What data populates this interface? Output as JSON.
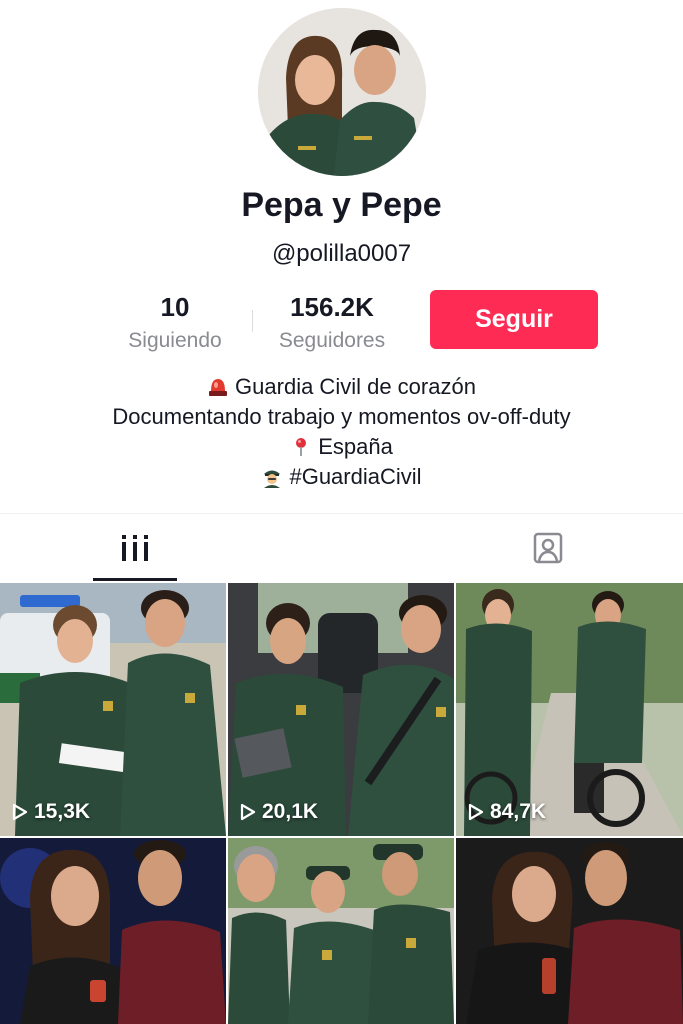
{
  "profile": {
    "display_name": "Pepa y Pepe",
    "username": "@polilla0007",
    "avatar_icon": "avatar-photo"
  },
  "stats": {
    "following_count": "10",
    "following_label": "Siguiendo",
    "followers_count": "156.2K",
    "followers_label": "Seguidores"
  },
  "follow_button": {
    "label": "Seguir",
    "color": "#fe2c55"
  },
  "bio": {
    "line1_icon": "siren-icon",
    "line1": "Guardia Civil de corazón",
    "line2": "Documentando trabajo y momentos ov-off-duty",
    "line3_icon": "pin-icon",
    "line3": "España",
    "line4_icon": "officer-icon",
    "line4": "#GuardiaCivil"
  },
  "tabs": [
    {
      "name": "videos",
      "icon": "grid-icon",
      "active": true
    },
    {
      "name": "tagged",
      "icon": "tagged-user-icon",
      "active": false
    }
  ],
  "videos": [
    {
      "views": "15,3K",
      "scene": "patrol car"
    },
    {
      "views": "20,1K",
      "scene": "car interior"
    },
    {
      "views": "84,7K",
      "scene": "bicycles"
    },
    {
      "views": "",
      "scene": "nightclub"
    },
    {
      "views": "",
      "scene": "group talk"
    },
    {
      "views": "",
      "scene": "nightclub drinks"
    }
  ]
}
